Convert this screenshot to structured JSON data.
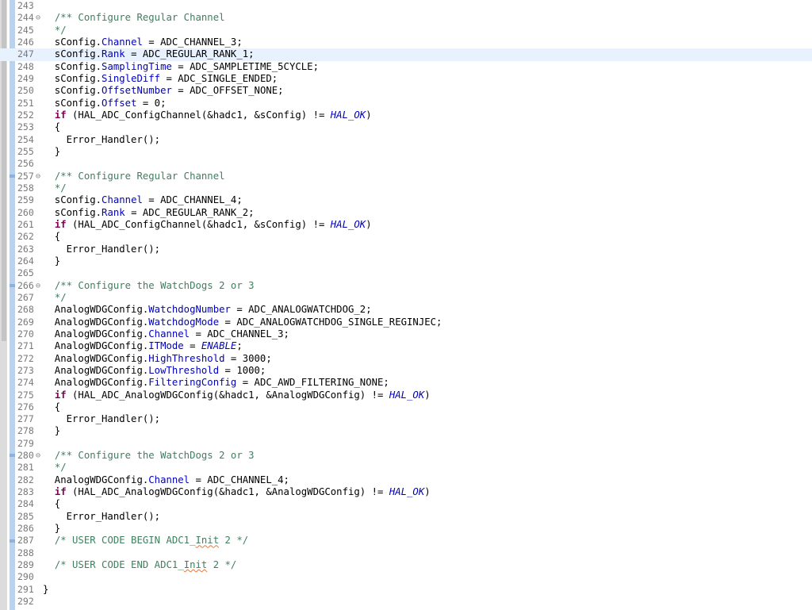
{
  "editor": {
    "lines": [
      {
        "n": "243",
        "segs": []
      },
      {
        "n": "244",
        "fold": "⊖",
        "segs": [
          {
            "t": "  ",
            "c": "pln"
          },
          {
            "t": "/** Configure Regular Channel",
            "c": "com"
          }
        ]
      },
      {
        "n": "245",
        "segs": [
          {
            "t": "  ",
            "c": "pln"
          },
          {
            "t": "*/",
            "c": "com"
          }
        ]
      },
      {
        "n": "246",
        "segs": [
          {
            "t": "  sConfig.",
            "c": "pln"
          },
          {
            "t": "Channel",
            "c": "fld"
          },
          {
            "t": " = ADC_CHANNEL_3;",
            "c": "pln"
          }
        ]
      },
      {
        "n": "247",
        "current": true,
        "segs": [
          {
            "t": "  sConfig.",
            "c": "pln"
          },
          {
            "t": "Rank",
            "c": "fld"
          },
          {
            "t": " = ADC_REGULAR_RANK_1;",
            "c": "pln"
          }
        ]
      },
      {
        "n": "248",
        "segs": [
          {
            "t": "  sConfig.",
            "c": "pln"
          },
          {
            "t": "SamplingTime",
            "c": "fld"
          },
          {
            "t": " = ADC_SAMPLETIME_5CYCLE;",
            "c": "pln"
          }
        ]
      },
      {
        "n": "249",
        "segs": [
          {
            "t": "  sConfig.",
            "c": "pln"
          },
          {
            "t": "SingleDiff",
            "c": "fld"
          },
          {
            "t": " = ADC_SINGLE_ENDED;",
            "c": "pln"
          }
        ]
      },
      {
        "n": "250",
        "segs": [
          {
            "t": "  sConfig.",
            "c": "pln"
          },
          {
            "t": "OffsetNumber",
            "c": "fld"
          },
          {
            "t": " = ADC_OFFSET_NONE;",
            "c": "pln"
          }
        ]
      },
      {
        "n": "251",
        "segs": [
          {
            "t": "  sConfig.",
            "c": "pln"
          },
          {
            "t": "Offset",
            "c": "fld"
          },
          {
            "t": " = 0;",
            "c": "pln"
          }
        ]
      },
      {
        "n": "252",
        "segs": [
          {
            "t": "  ",
            "c": "pln"
          },
          {
            "t": "if",
            "c": "kw"
          },
          {
            "t": " (HAL_ADC_ConfigChannel(&hadc1, &sConfig) != ",
            "c": "pln"
          },
          {
            "t": "HAL_OK",
            "c": "mac"
          },
          {
            "t": ")",
            "c": "pln"
          }
        ]
      },
      {
        "n": "253",
        "segs": [
          {
            "t": "  {",
            "c": "pln"
          }
        ]
      },
      {
        "n": "254",
        "segs": [
          {
            "t": "    Error_Handler();",
            "c": "pln"
          }
        ]
      },
      {
        "n": "255",
        "segs": [
          {
            "t": "  }",
            "c": "pln"
          }
        ]
      },
      {
        "n": "256",
        "segs": []
      },
      {
        "n": "257",
        "fold": "⊖",
        "segs": [
          {
            "t": "  ",
            "c": "pln"
          },
          {
            "t": "/** Configure Regular Channel",
            "c": "com"
          }
        ]
      },
      {
        "n": "258",
        "segs": [
          {
            "t": "  ",
            "c": "pln"
          },
          {
            "t": "*/",
            "c": "com"
          }
        ]
      },
      {
        "n": "259",
        "segs": [
          {
            "t": "  sConfig.",
            "c": "pln"
          },
          {
            "t": "Channel",
            "c": "fld"
          },
          {
            "t": " = ADC_CHANNEL_4;",
            "c": "pln"
          }
        ]
      },
      {
        "n": "260",
        "segs": [
          {
            "t": "  sConfig.",
            "c": "pln"
          },
          {
            "t": "Rank",
            "c": "fld"
          },
          {
            "t": " = ADC_REGULAR_RANK_2;",
            "c": "pln"
          }
        ]
      },
      {
        "n": "261",
        "segs": [
          {
            "t": "  ",
            "c": "pln"
          },
          {
            "t": "if",
            "c": "kw"
          },
          {
            "t": " (HAL_ADC_ConfigChannel(&hadc1, &sConfig) != ",
            "c": "pln"
          },
          {
            "t": "HAL_OK",
            "c": "mac"
          },
          {
            "t": ")",
            "c": "pln"
          }
        ]
      },
      {
        "n": "262",
        "segs": [
          {
            "t": "  {",
            "c": "pln"
          }
        ]
      },
      {
        "n": "263",
        "segs": [
          {
            "t": "    Error_Handler();",
            "c": "pln"
          }
        ]
      },
      {
        "n": "264",
        "segs": [
          {
            "t": "  }",
            "c": "pln"
          }
        ]
      },
      {
        "n": "265",
        "segs": []
      },
      {
        "n": "266",
        "fold": "⊖",
        "segs": [
          {
            "t": "  ",
            "c": "pln"
          },
          {
            "t": "/** Configure the WatchDogs 2 or 3",
            "c": "com"
          }
        ]
      },
      {
        "n": "267",
        "segs": [
          {
            "t": "  ",
            "c": "pln"
          },
          {
            "t": "*/",
            "c": "com"
          }
        ]
      },
      {
        "n": "268",
        "segs": [
          {
            "t": "  AnalogWDGConfig.",
            "c": "pln"
          },
          {
            "t": "WatchdogNumber",
            "c": "fld"
          },
          {
            "t": " = ADC_ANALOGWATCHDOG_2;",
            "c": "pln"
          }
        ]
      },
      {
        "n": "269",
        "segs": [
          {
            "t": "  AnalogWDGConfig.",
            "c": "pln"
          },
          {
            "t": "WatchdogMode",
            "c": "fld"
          },
          {
            "t": " = ADC_ANALOGWATCHDOG_SINGLE_REGINJEC;",
            "c": "pln"
          }
        ]
      },
      {
        "n": "270",
        "segs": [
          {
            "t": "  AnalogWDGConfig.",
            "c": "pln"
          },
          {
            "t": "Channel",
            "c": "fld"
          },
          {
            "t": " = ADC_CHANNEL_3;",
            "c": "pln"
          }
        ]
      },
      {
        "n": "271",
        "segs": [
          {
            "t": "  AnalogWDGConfig.",
            "c": "pln"
          },
          {
            "t": "ITMode",
            "c": "fld"
          },
          {
            "t": " = ",
            "c": "pln"
          },
          {
            "t": "ENABLE",
            "c": "mac"
          },
          {
            "t": ";",
            "c": "pln"
          }
        ]
      },
      {
        "n": "272",
        "segs": [
          {
            "t": "  AnalogWDGConfig.",
            "c": "pln"
          },
          {
            "t": "HighThreshold",
            "c": "fld"
          },
          {
            "t": " = 3000;",
            "c": "pln"
          }
        ]
      },
      {
        "n": "273",
        "segs": [
          {
            "t": "  AnalogWDGConfig.",
            "c": "pln"
          },
          {
            "t": "LowThreshold",
            "c": "fld"
          },
          {
            "t": " = 1000;",
            "c": "pln"
          }
        ]
      },
      {
        "n": "274",
        "segs": [
          {
            "t": "  AnalogWDGConfig.",
            "c": "pln"
          },
          {
            "t": "FilteringConfig",
            "c": "fld"
          },
          {
            "t": " = ADC_AWD_FILTERING_NONE;",
            "c": "pln"
          }
        ]
      },
      {
        "n": "275",
        "segs": [
          {
            "t": "  ",
            "c": "pln"
          },
          {
            "t": "if",
            "c": "kw"
          },
          {
            "t": " (HAL_ADC_AnalogWDGConfig(&hadc1, &AnalogWDGConfig) != ",
            "c": "pln"
          },
          {
            "t": "HAL_OK",
            "c": "mac"
          },
          {
            "t": ")",
            "c": "pln"
          }
        ]
      },
      {
        "n": "276",
        "segs": [
          {
            "t": "  {",
            "c": "pln"
          }
        ]
      },
      {
        "n": "277",
        "segs": [
          {
            "t": "    Error_Handler();",
            "c": "pln"
          }
        ]
      },
      {
        "n": "278",
        "segs": [
          {
            "t": "  }",
            "c": "pln"
          }
        ]
      },
      {
        "n": "279",
        "segs": []
      },
      {
        "n": "280",
        "fold": "⊖",
        "segs": [
          {
            "t": "  ",
            "c": "pln"
          },
          {
            "t": "/** Configure the WatchDogs 2 or 3",
            "c": "com"
          }
        ]
      },
      {
        "n": "281",
        "segs": [
          {
            "t": "  ",
            "c": "pln"
          },
          {
            "t": "*/",
            "c": "com"
          }
        ]
      },
      {
        "n": "282",
        "segs": [
          {
            "t": "  AnalogWDGConfig.",
            "c": "pln"
          },
          {
            "t": "Channel",
            "c": "fld"
          },
          {
            "t": " = ADC_CHANNEL_4;",
            "c": "pln"
          }
        ]
      },
      {
        "n": "283",
        "segs": [
          {
            "t": "  ",
            "c": "pln"
          },
          {
            "t": "if",
            "c": "kw"
          },
          {
            "t": " (HAL_ADC_AnalogWDGConfig(&hadc1, &AnalogWDGConfig) != ",
            "c": "pln"
          },
          {
            "t": "HAL_OK",
            "c": "mac"
          },
          {
            "t": ")",
            "c": "pln"
          }
        ]
      },
      {
        "n": "284",
        "segs": [
          {
            "t": "  {",
            "c": "pln"
          }
        ]
      },
      {
        "n": "285",
        "segs": [
          {
            "t": "    Error_Handler();",
            "c": "pln"
          }
        ]
      },
      {
        "n": "286",
        "segs": [
          {
            "t": "  }",
            "c": "pln"
          }
        ]
      },
      {
        "n": "287",
        "segs": [
          {
            "t": "  ",
            "c": "pln"
          },
          {
            "t": "/* USER CODE BEGIN ADC1_",
            "c": "com"
          },
          {
            "t": "Init",
            "c": "com",
            "spell": true
          },
          {
            "t": " 2 */",
            "c": "com"
          }
        ]
      },
      {
        "n": "288",
        "segs": []
      },
      {
        "n": "289",
        "segs": [
          {
            "t": "  ",
            "c": "pln"
          },
          {
            "t": "/* USER CODE END ADC1_",
            "c": "com"
          },
          {
            "t": "Init",
            "c": "com",
            "spell": true
          },
          {
            "t": " 2 */",
            "c": "com"
          }
        ]
      },
      {
        "n": "290",
        "segs": []
      },
      {
        "n": "291",
        "segs": [
          {
            "t": "}",
            "c": "pln"
          }
        ]
      },
      {
        "n": "292",
        "segs": []
      }
    ]
  },
  "colors": {
    "comment": "#3f7f5f",
    "keyword": "#7f0055",
    "field": "#0000c0",
    "macro": "#0000c0",
    "line_number": "#787878",
    "current_line": "#e8f2fe",
    "ruler": "#bcd2ec"
  },
  "icons": {
    "fold": "fold-collapse-icon"
  }
}
